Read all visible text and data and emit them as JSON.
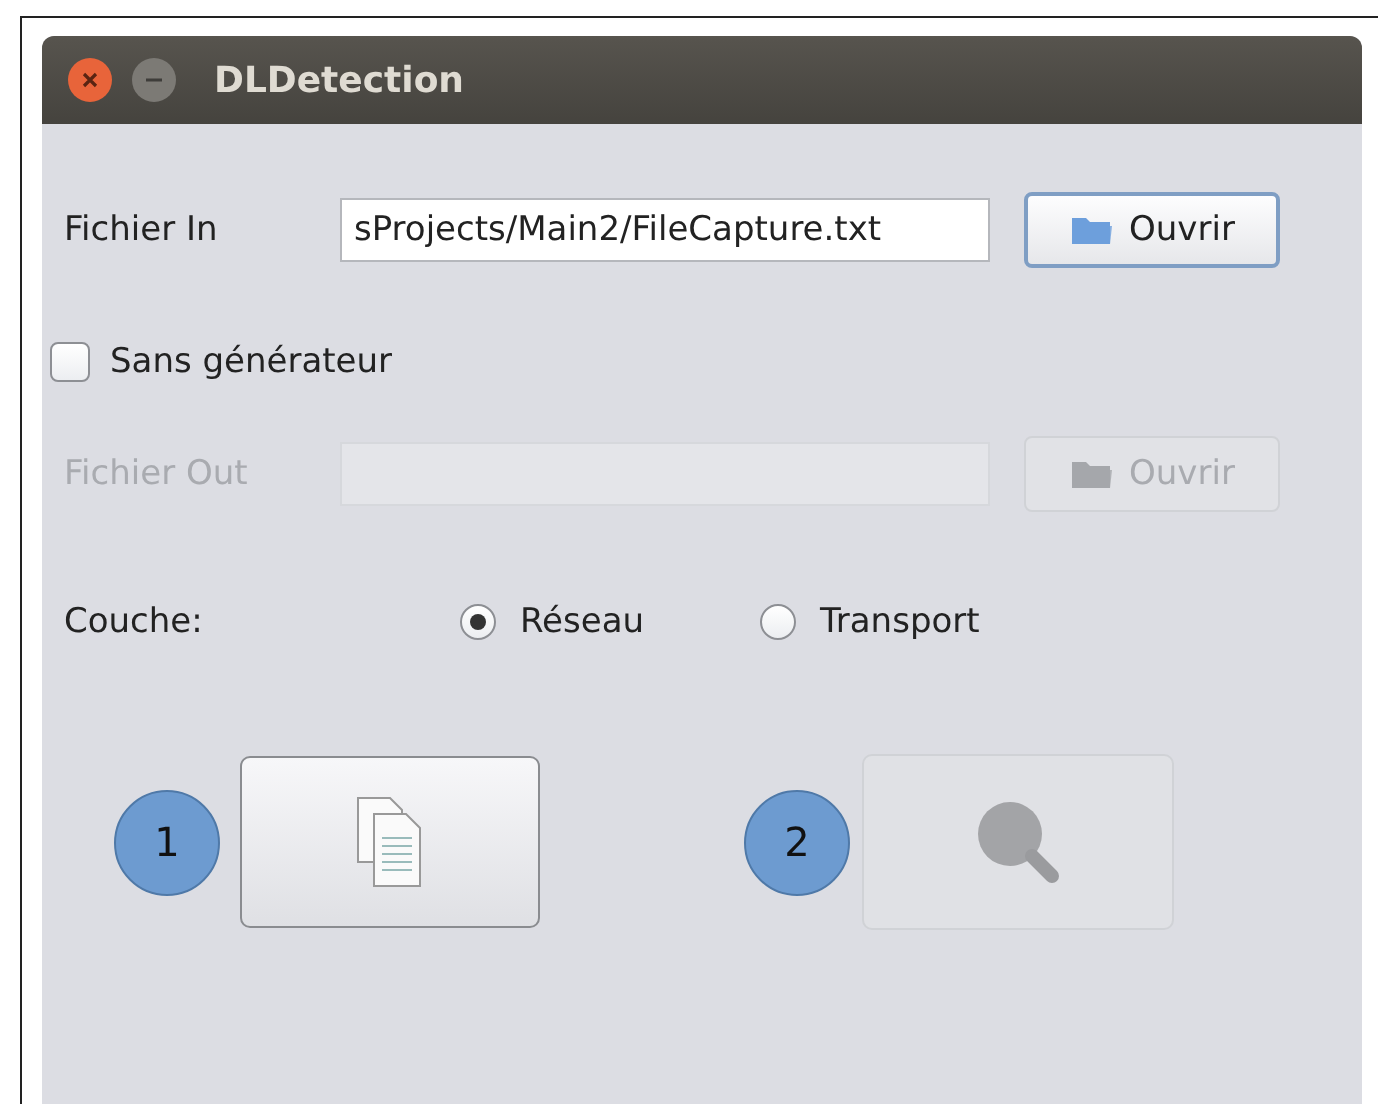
{
  "window": {
    "title": "DLDetection"
  },
  "file_in": {
    "label": "Fichier In",
    "value": "sProjects/Main2/FileCapture.txt",
    "button": "Ouvrir",
    "disabled": false
  },
  "generator_checkbox": {
    "label": "Sans générateur",
    "checked": false
  },
  "file_out": {
    "label": "Fichier Out",
    "button": "Ouvrir",
    "disabled": true
  },
  "layer": {
    "label": "Couche:",
    "options": [
      {
        "label": "Réseau",
        "selected": true
      },
      {
        "label": "Transport",
        "selected": false
      }
    ]
  },
  "steps": [
    {
      "number": "1",
      "kind": "document",
      "disabled": false
    },
    {
      "number": "2",
      "kind": "search",
      "disabled": true
    }
  ]
}
